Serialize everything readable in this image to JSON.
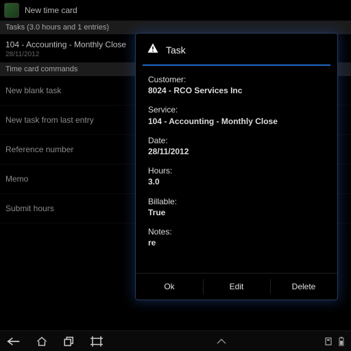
{
  "titlebar": {
    "title": "New time card"
  },
  "tasks_header": "Tasks (3.0 hours and 1 entries)",
  "task_entry": {
    "title": "104 - Accounting - Monthly Close",
    "date": "28/11/2012"
  },
  "commands_header": "Time card commands",
  "commands": {
    "new_blank": "New blank task",
    "new_from_last": "New task from last entry",
    "reference_number": "Reference number",
    "memo": "Memo",
    "submit_hours": "Submit hours"
  },
  "modal": {
    "title": "Task",
    "labels": {
      "customer": "Customer:",
      "service": "Service:",
      "date": "Date:",
      "hours": "Hours:",
      "billable": "Billable:",
      "notes": "Notes:"
    },
    "values": {
      "customer": "8024 - RCO Services Inc",
      "service": "104 - Accounting - Monthly Close",
      "date": "28/11/2012",
      "hours": "3.0",
      "billable": "True",
      "notes": "re"
    },
    "buttons": {
      "ok": "Ok",
      "edit": "Edit",
      "delete": "Delete"
    }
  }
}
